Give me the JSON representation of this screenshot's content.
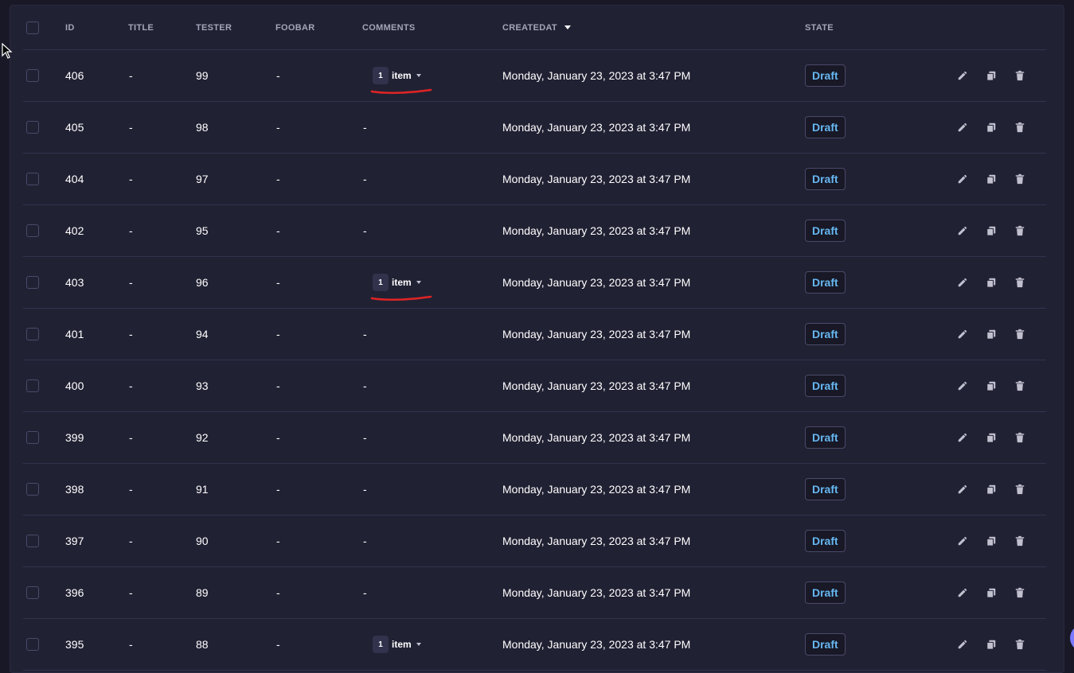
{
  "header": {
    "id": "ID",
    "title": "TITLE",
    "tester": "TESTER",
    "foobar": "FOOBAR",
    "comments": "COMMENTS",
    "createdat": "CREATEDAT",
    "state": "STATE"
  },
  "rows": [
    {
      "id": "406",
      "title": "-",
      "tester": "99",
      "foobar": "-",
      "comments_count": "1",
      "comments_label": "item",
      "created": "Monday, January 23, 2023 at 3:47 PM",
      "state": "Draft"
    },
    {
      "id": "405",
      "title": "-",
      "tester": "98",
      "foobar": "-",
      "comments": "-",
      "created": "Monday, January 23, 2023 at 3:47 PM",
      "state": "Draft"
    },
    {
      "id": "404",
      "title": "-",
      "tester": "97",
      "foobar": "-",
      "comments": "-",
      "created": "Monday, January 23, 2023 at 3:47 PM",
      "state": "Draft"
    },
    {
      "id": "402",
      "title": "-",
      "tester": "95",
      "foobar": "-",
      "comments": "-",
      "created": "Monday, January 23, 2023 at 3:47 PM",
      "state": "Draft"
    },
    {
      "id": "403",
      "title": "-",
      "tester": "96",
      "foobar": "-",
      "comments_count": "1",
      "comments_label": "item",
      "created": "Monday, January 23, 2023 at 3:47 PM",
      "state": "Draft"
    },
    {
      "id": "401",
      "title": "-",
      "tester": "94",
      "foobar": "-",
      "comments": "-",
      "created": "Monday, January 23, 2023 at 3:47 PM",
      "state": "Draft"
    },
    {
      "id": "400",
      "title": "-",
      "tester": "93",
      "foobar": "-",
      "comments": "-",
      "created": "Monday, January 23, 2023 at 3:47 PM",
      "state": "Draft"
    },
    {
      "id": "399",
      "title": "-",
      "tester": "92",
      "foobar": "-",
      "comments": "-",
      "created": "Monday, January 23, 2023 at 3:47 PM",
      "state": "Draft"
    },
    {
      "id": "398",
      "title": "-",
      "tester": "91",
      "foobar": "-",
      "comments": "-",
      "created": "Monday, January 23, 2023 at 3:47 PM",
      "state": "Draft"
    },
    {
      "id": "397",
      "title": "-",
      "tester": "90",
      "foobar": "-",
      "comments": "-",
      "created": "Monday, January 23, 2023 at 3:47 PM",
      "state": "Draft"
    },
    {
      "id": "396",
      "title": "-",
      "tester": "89",
      "foobar": "-",
      "comments": "-",
      "created": "Monday, January 23, 2023 at 3:47 PM",
      "state": "Draft"
    },
    {
      "id": "395",
      "title": "-",
      "tester": "88",
      "foobar": "-",
      "comments_count": "1",
      "comments_label": "item",
      "created": "Monday, January 23, 2023 at 3:47 PM",
      "state": "Draft"
    }
  ],
  "icons": {
    "edit": "pencil-icon",
    "duplicate": "duplicate-icon",
    "delete": "trash-icon"
  },
  "colors": {
    "background": "#181826",
    "panel": "#212134",
    "state_text": "#66b7f1",
    "annotation": "#e02424"
  }
}
